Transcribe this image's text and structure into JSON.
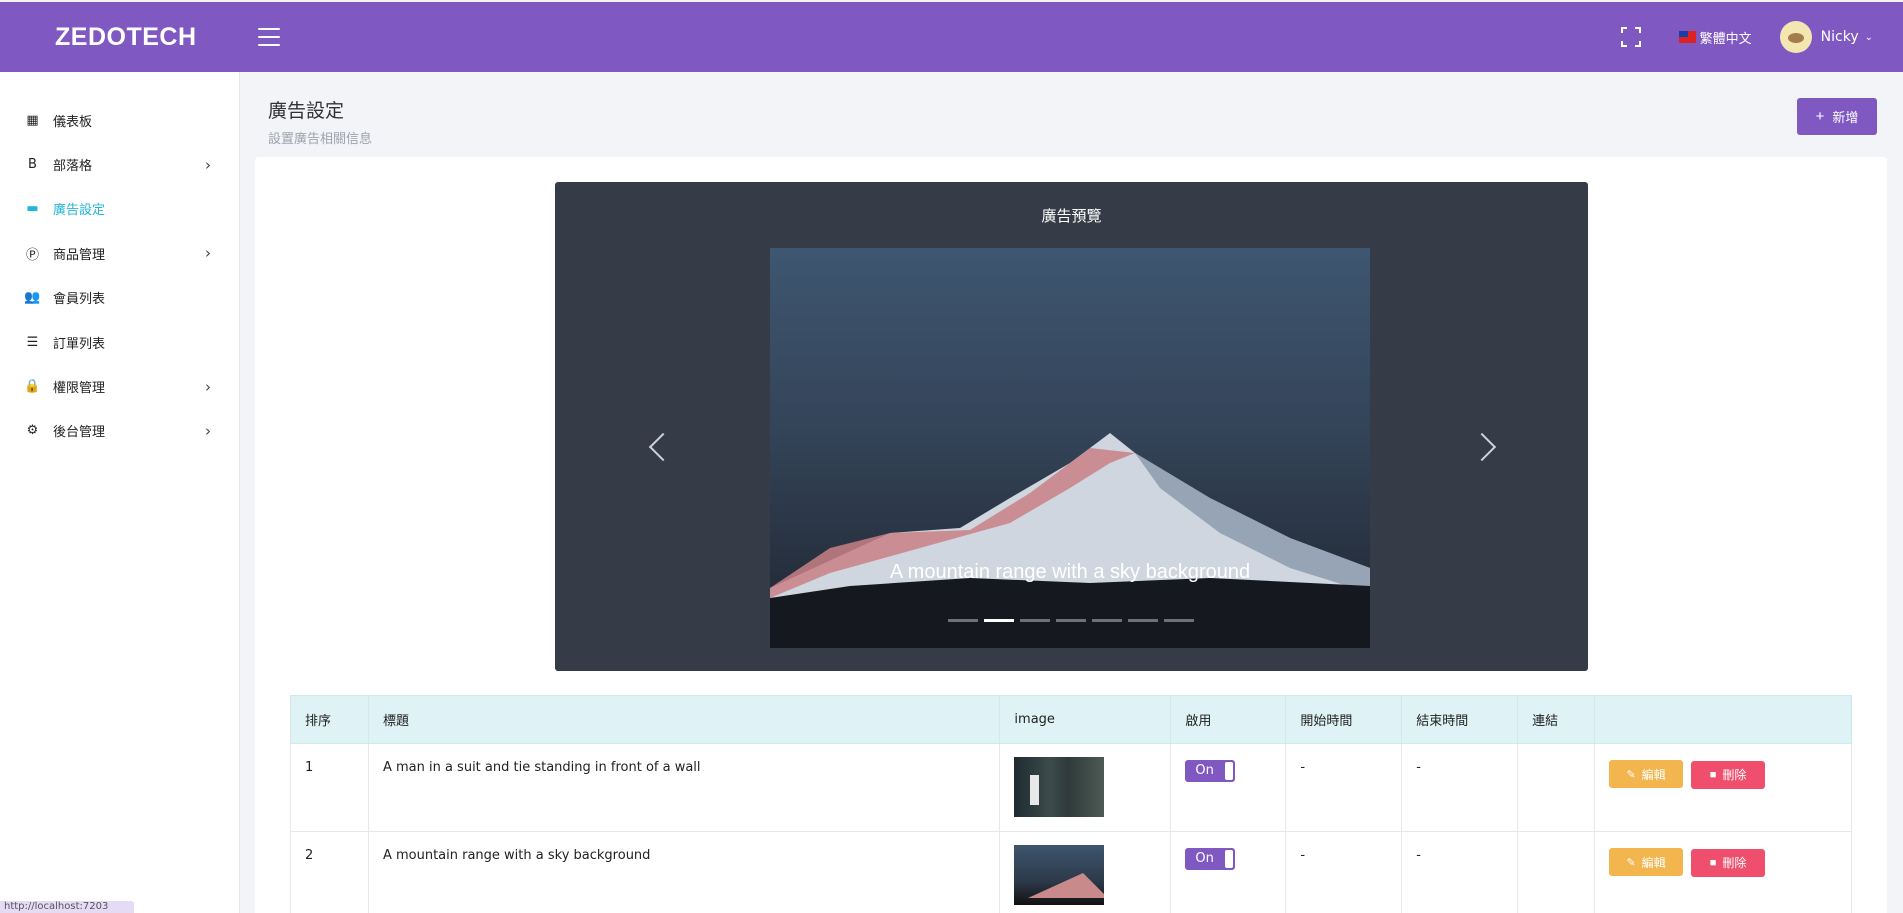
{
  "header": {
    "brand": "ZEDOTECH",
    "language": "繁體中文",
    "user_name": "Nicky",
    "caret": "⌄",
    "accent_color": "#7f58c2"
  },
  "sidebar": {
    "items": [
      {
        "label": "儀表板",
        "icon": "dashboard-icon",
        "glyph": "▦",
        "has_children": false
      },
      {
        "label": "部落格",
        "icon": "blog-icon",
        "glyph": "B",
        "has_children": true
      },
      {
        "label": "廣告設定",
        "icon": "ad-icon",
        "glyph": "▬",
        "has_children": false,
        "active": true
      },
      {
        "label": "商品管理",
        "icon": "product-icon",
        "glyph": "Ⓟ",
        "has_children": true
      },
      {
        "label": "會員列表",
        "icon": "members-icon",
        "glyph": "👥",
        "has_children": false
      },
      {
        "label": "訂單列表",
        "icon": "orders-icon",
        "glyph": "☰",
        "has_children": false
      },
      {
        "label": "權限管理",
        "icon": "permission-icon",
        "glyph": "🔒",
        "has_children": true
      },
      {
        "label": "後台管理",
        "icon": "settings-icon",
        "glyph": "⚙",
        "has_children": true
      }
    ],
    "arrow": "›"
  },
  "page": {
    "title": "廣告設定",
    "subtitle": "設置廣告相關信息",
    "add_plus": "+",
    "add_label": "新增"
  },
  "preview": {
    "title": "廣告預覽",
    "caption": "A mountain range with a sky background",
    "slide_count": 7,
    "active_index": 1
  },
  "table": {
    "headers": [
      "排序",
      "標題",
      "image",
      "啟用",
      "開始時間",
      "結束時間",
      "連結",
      ""
    ],
    "rows": [
      {
        "order": "1",
        "title": "A man in a suit and tie standing in front of a wall",
        "enabled": "On",
        "start": "-",
        "end": "-",
        "link": ""
      },
      {
        "order": "2",
        "title": "A mountain range with a sky background",
        "enabled": "On",
        "start": "-",
        "end": "-",
        "link": ""
      }
    ],
    "edit_label": "編輯",
    "delete_label": "刪除"
  },
  "statusbar": {
    "text": "http://localhost:7203"
  }
}
